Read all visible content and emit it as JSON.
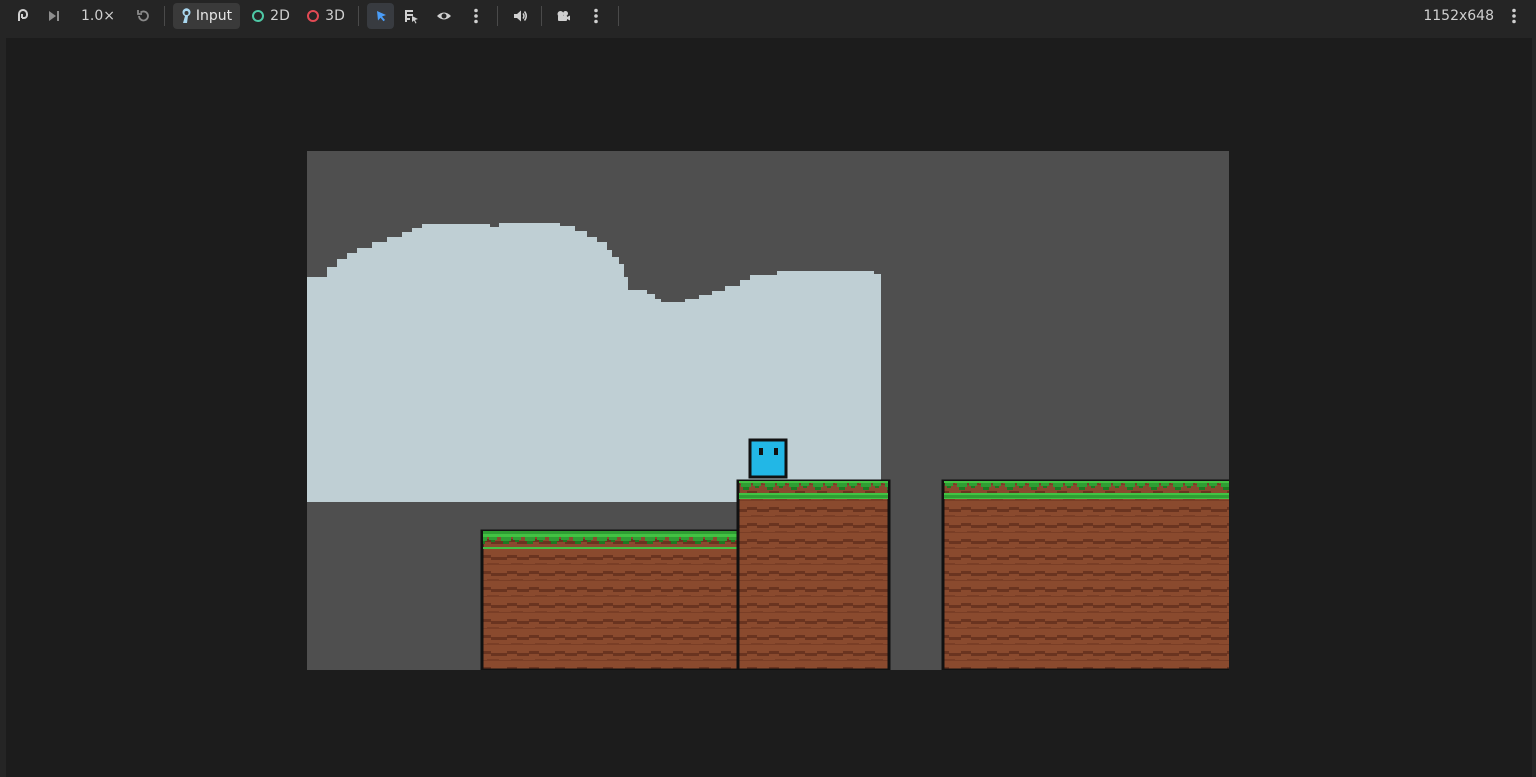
{
  "toolbar": {
    "speed_label": "1.0×",
    "input_label": "Input",
    "mode_2d_label": "2D",
    "mode_3d_label": "3D",
    "resolution_label": "1152x648",
    "colors": {
      "accent_select": "#4a9df8",
      "ring_2d": "#4ec9a6",
      "ring_3d": "#e24a54"
    },
    "icons": [
      "suspend-icon",
      "next-frame-icon",
      "reset-speed-icon",
      "input-icon",
      "select-icon",
      "list-select-icon",
      "visibility-icon",
      "more-options-icon",
      "audio-icon",
      "camera-override-icon",
      "camera-options-icon",
      "main-menu-icon"
    ]
  },
  "game": {
    "sky_color": "#bfcfd4",
    "background_color": "#4f4f4f",
    "dirt_color": "#8a4a2e",
    "dirt_dark_color": "#6a3420",
    "grass_color": "#3cb83c",
    "grass_dark_color": "#1e7a22",
    "player_color": "#22b7e6"
  }
}
